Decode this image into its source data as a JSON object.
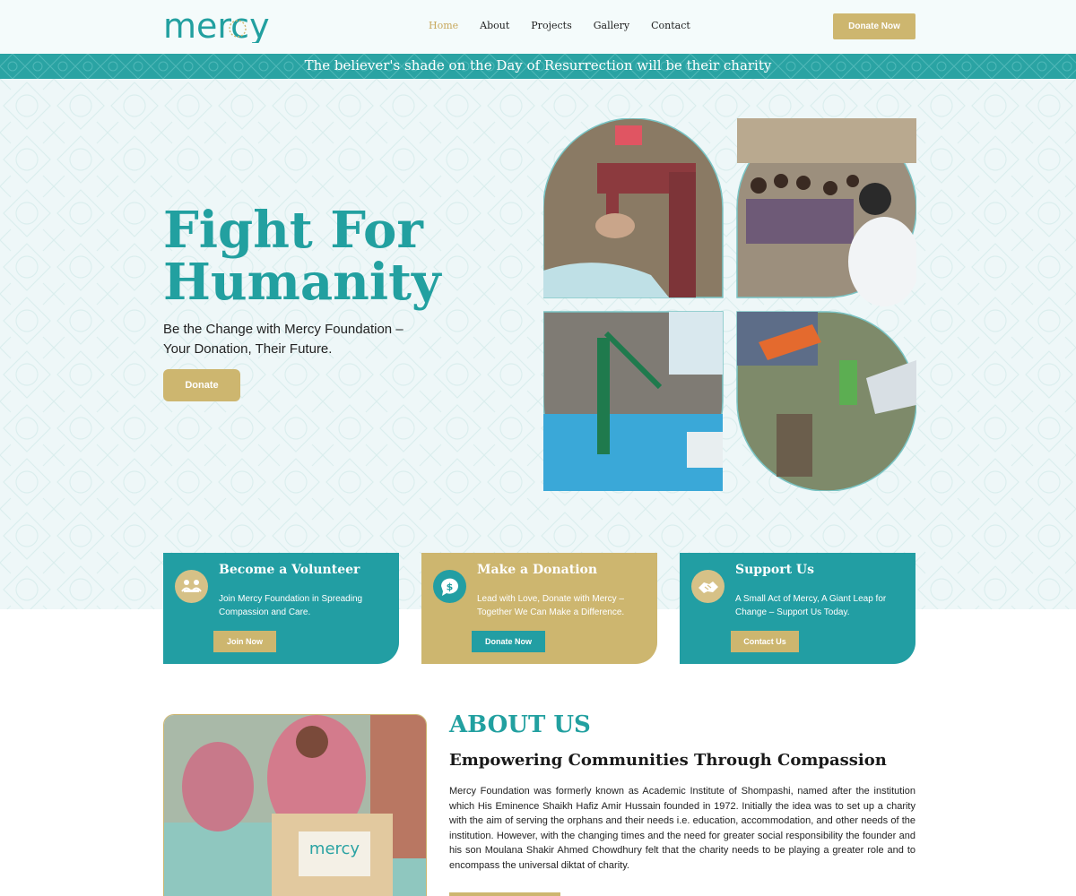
{
  "header": {
    "logo_text": "mercy",
    "nav": [
      {
        "label": "Home",
        "active": true
      },
      {
        "label": "About",
        "active": false
      },
      {
        "label": "Projects",
        "active": false
      },
      {
        "label": "Gallery",
        "active": false
      },
      {
        "label": "Contact",
        "active": false
      }
    ],
    "donate_label": "Donate Now"
  },
  "banner": {
    "text": "The believer's shade on the Day of Resurrection will be their charity"
  },
  "hero": {
    "title_line1": "Fight For",
    "title_line2": "Humanity",
    "subtitle": "Be the Change with Mercy Foundation – Your Donation, Their Future.",
    "button_label": "Donate"
  },
  "cards": [
    {
      "title": "Become a Volunteer",
      "text": "Join Mercy Foundation in Spreading Compassion and Care.",
      "button": "Join Now",
      "icon": "volunteer-people-icon"
    },
    {
      "title": "Make a Donation",
      "text": "Lead with Love, Donate with Mercy – Together We Can Make a Difference.",
      "button": "Donate Now",
      "icon": "dollar-chat-icon"
    },
    {
      "title": "Support Us",
      "text": "A Small Act of Mercy, A Giant Leap for Change – Support Us Today.",
      "button": "Contact Us",
      "icon": "handshake-icon"
    }
  ],
  "about": {
    "heading": "ABOUT US",
    "subheading": "Empowering Communities Through Compassion",
    "body": "Mercy Foundation was formerly known as Academic Institute of Shompashi, named after the institution which His Eminence Shaikh Hafiz Amir Hussain founded in 1972. Initially the idea was to set up a charity with the aim of serving the orphans and their needs i.e. education, accommodation, and other needs of the institution. However, with the changing times and the need for greater social responsibility the founder and his son Moulana Shakir Ahmed Chowdhury felt that the charity needs to be playing a greater role and to encompass the universal diktat of charity.",
    "box_label": "mercy"
  },
  "colors": {
    "teal": "#229ea3",
    "gold": "#cdb66f",
    "nav_active": "#c8a85c"
  }
}
